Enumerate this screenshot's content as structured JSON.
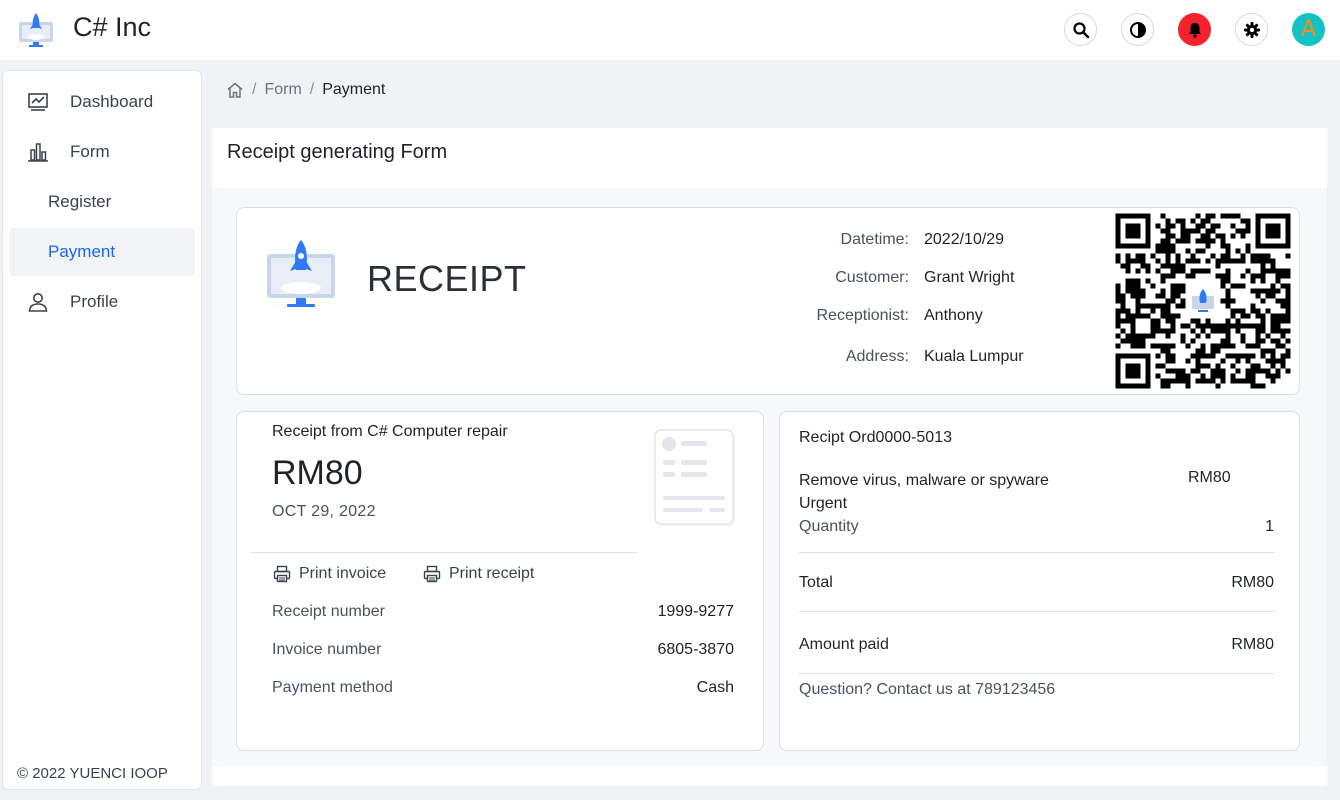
{
  "header": {
    "app_title": "C# Inc",
    "avatar_letter": "A",
    "actions": [
      "search-icon",
      "theme-toggle-icon",
      "bell-icon",
      "gear-icon"
    ],
    "bell_color": "#f5222d",
    "avatar_bg": "#13c2c2"
  },
  "sidebar": {
    "items": [
      {
        "label": "Dashboard",
        "icon": "dashboard-icon"
      },
      {
        "label": "Form",
        "icon": "bar-chart-icon"
      },
      {
        "label": "Register"
      },
      {
        "label": "Payment",
        "active": true
      },
      {
        "label": "Profile",
        "icon": "user-icon"
      }
    ],
    "copyright": "© 2022 YUENCI IOOP",
    "active_color": "#1664ff"
  },
  "breadcrumb": {
    "home_icon": "home-icon",
    "items": [
      "Form",
      "Payment"
    ],
    "separator": "/"
  },
  "form": {
    "title": "Receipt generating Form"
  },
  "receipt": {
    "heading": "RECEIPT",
    "fields": [
      {
        "label": "Datetime:",
        "value": "2022/10/29"
      },
      {
        "label": "Customer:",
        "value": "Grant Wright"
      },
      {
        "label": "Receptionist:",
        "value": "Anthony"
      },
      {
        "label": "Address:",
        "value": "Kuala Lumpur"
      }
    ]
  },
  "summary": {
    "from": "Receipt from C# Computer repair",
    "amount": "RM80",
    "date": "OCT 29, 2022",
    "print_invoice": "Print invoice",
    "print_receipt": "Print receipt",
    "rows": [
      {
        "label": "Receipt number",
        "value": "1999-9277"
      },
      {
        "label": "Invoice number",
        "value": "6805-3870"
      },
      {
        "label": "Payment method",
        "value": "Cash"
      }
    ]
  },
  "order": {
    "title": "Recipt Ord0000-5013",
    "item_name": "Remove virus, malware or spyware",
    "item_tag": "Urgent",
    "item_price": "RM80",
    "quantity_label": "Quantity",
    "quantity_value": "1",
    "total_label": "Total",
    "total_value": "RM80",
    "paid_label": "Amount paid",
    "paid_value": "RM80",
    "contact": "Question? Contact us at 789123456"
  }
}
